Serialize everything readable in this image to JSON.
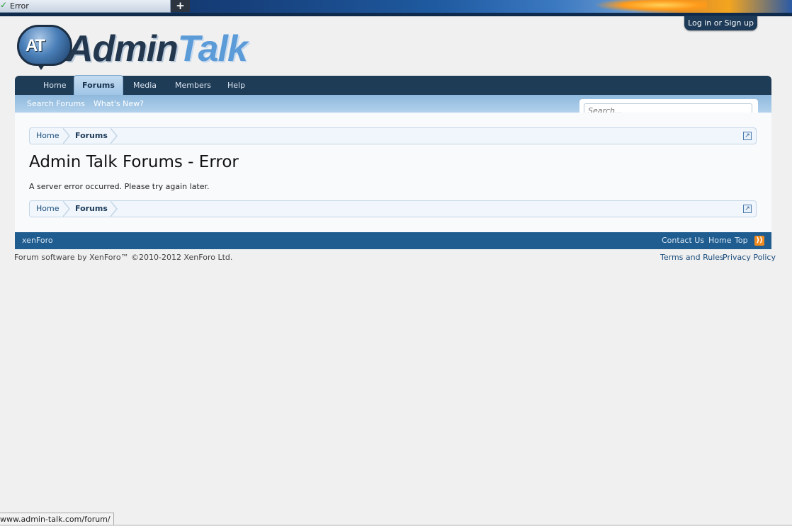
{
  "browser": {
    "tab_title": "Error",
    "new_tab_symbol": "+",
    "status_url": "www.admin-talk.com/forum/"
  },
  "header": {
    "login_label": "Log in or Sign up",
    "logo_mark": "AT",
    "logo_word_a": "Admin",
    "logo_word_b": "Talk"
  },
  "nav": {
    "tabs": [
      "Home",
      "Forums",
      "Media",
      "Members",
      "Help"
    ],
    "active_tab": "Forums",
    "sub": [
      "Search Forums",
      "What's New?"
    ],
    "search_placeholder": "Search..."
  },
  "breadcrumb": {
    "items": [
      "Home",
      "Forums"
    ]
  },
  "main": {
    "title": "Admin Talk Forums - Error",
    "message": "A server error occurred. Please try again later."
  },
  "footer": {
    "brand": "xenForo",
    "links": [
      "Contact Us",
      "Home",
      "Top"
    ],
    "copyright": "Forum software by XenForo™ ©2010-2012 XenForo Ltd.",
    "legal": [
      "Terms and Rules",
      "Privacy Policy"
    ]
  },
  "colors": {
    "nav_bg": "#1f3c57",
    "subnav_bg": "#9ec4e6",
    "footer_bg": "#1f5d90",
    "link": "#1d4e7d"
  },
  "icons": [
    "check-icon",
    "plus-icon",
    "jump-icon",
    "rss-icon"
  ]
}
